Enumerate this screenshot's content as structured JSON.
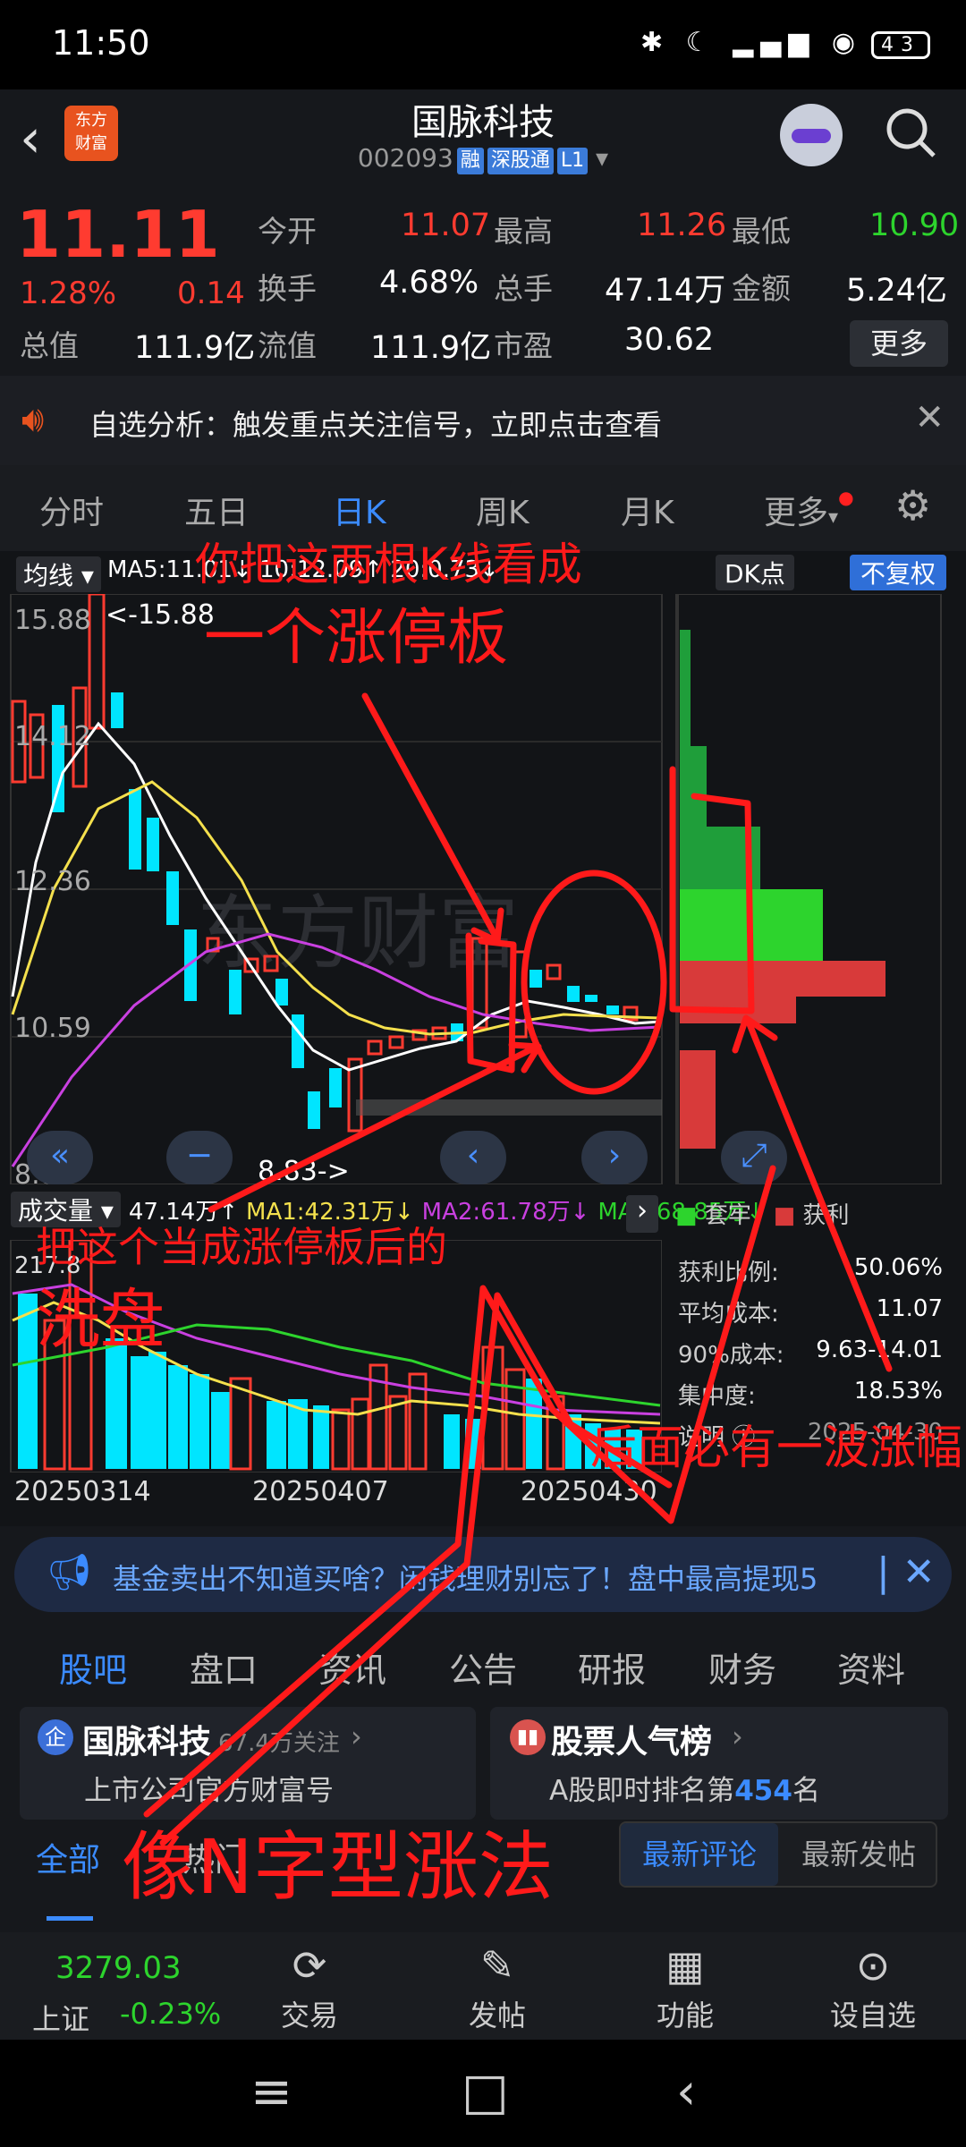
{
  "status": {
    "time": "11:50",
    "battery": "43"
  },
  "header": {
    "title": "国脉科技",
    "code": "002093",
    "tags": [
      "融",
      "深股通",
      "L1"
    ],
    "logo": "东方\n财富"
  },
  "quote": {
    "price": "11.11",
    "pct": "1.28%",
    "change": "0.14",
    "fields": [
      {
        "label": "今开",
        "value": "11.07"
      },
      {
        "label": "最高",
        "value": "11.26"
      },
      {
        "label": "最低",
        "value": "10.90"
      },
      {
        "label": "换手",
        "value": "4.68%"
      },
      {
        "label": "总手",
        "value": "47.14万"
      },
      {
        "label": "金额",
        "value": "5.24亿"
      },
      {
        "label": "总值",
        "value": "111.9亿"
      },
      {
        "label": "流值",
        "value": "111.9亿"
      },
      {
        "label": "市盈",
        "value": "30.62"
      }
    ],
    "more": "更多"
  },
  "notice": {
    "text": "自选分析：触发重点关注信号，立即点击查看"
  },
  "tabs": [
    "分时",
    "五日",
    "日K",
    "周K",
    "月K",
    "更多"
  ],
  "chart": {
    "ma_select": "均线",
    "ma5": "MA5:11.01↓ 10:12.09↑ 20:0.73↓",
    "dk": "DK点",
    "fq": "不复权",
    "y_labels": [
      "15.88",
      "14.12",
      "12.36",
      "10.59",
      "8.83"
    ],
    "high_mark": "<-15.88",
    "low_mark": "8.83->",
    "vol_select": "成交量",
    "vol_info": "47.14万↑",
    "vol_ma1": "MA1:42.31万↓",
    "vol_ma2": "MA2:61.78万↓",
    "vol_ma3": "MA3:68.85万↓",
    "vol_top": "217.8",
    "dates": [
      "20250314",
      "20250407",
      "20250430"
    ],
    "legend": [
      "套牢",
      "获利"
    ],
    "stats": [
      {
        "label": "获利比例:",
        "value": "50.06%"
      },
      {
        "label": "平均成本:",
        "value": "11.07"
      },
      {
        "label": "90%成本:",
        "value": "9.63-14.01"
      },
      {
        "label": "集中度:",
        "value": "18.53%"
      }
    ],
    "stats_note": "说明",
    "stats_date": "2025-04-30",
    "watermark": "东方财富"
  },
  "ad": {
    "text": "基金卖出不知道买啥？闲钱理财别忘了！盘中最高提现5"
  },
  "subtabs": [
    "股吧",
    "盘口",
    "资讯",
    "公告",
    "研报",
    "财务",
    "资料"
  ],
  "cards": [
    {
      "title": "国脉科技",
      "meta": "67.4万关注",
      "sub": "上市公司官方财富号"
    },
    {
      "title": "股票人气榜",
      "sub_prefix": "A股即时排名第",
      "rank": "454",
      "sub_suffix": "名"
    }
  ],
  "filters": {
    "all": "全部",
    "hot": "热门",
    "latest_comment": "最新评论",
    "latest_post": "最新发帖"
  },
  "bottom": {
    "index_value": "3279.03",
    "index_name": "上证",
    "index_pct": "-0.23%",
    "items": [
      "交易",
      "发帖",
      "功能",
      "设自选"
    ]
  },
  "annotations": [
    "你把这两根K线看成",
    "一个涨停板",
    "把这个当成涨停板后的",
    "洗盘",
    "后面必有一波涨幅",
    "像N字型涨法"
  ],
  "colors": {
    "up": "#ff3b30",
    "down": "#00e5ff",
    "accent": "#3b8bff",
    "annotation": "#ff1a1a"
  }
}
